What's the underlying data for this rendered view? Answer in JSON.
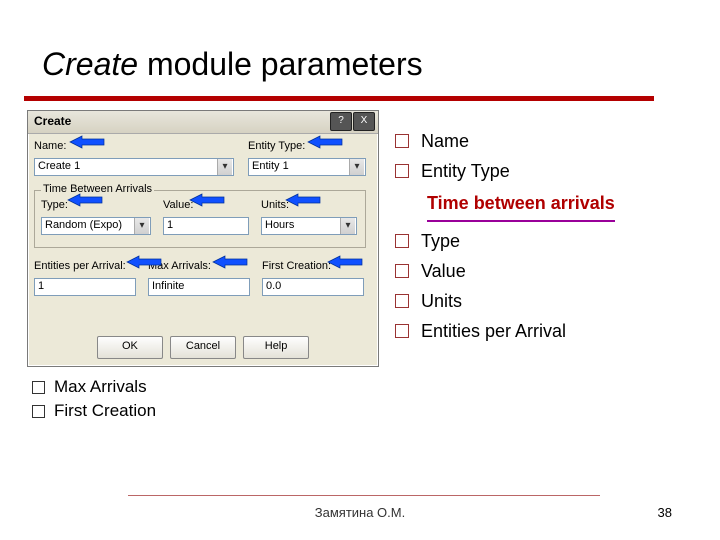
{
  "title": {
    "italic": "Create",
    "rest": " module parameters"
  },
  "dialog": {
    "title": "Create",
    "labels": {
      "name": "Name:",
      "entity_type": "Entity Type:",
      "group": "Time Between Arrivals",
      "type": "Type:",
      "value": "Value:",
      "units": "Units:",
      "entities_per": "Entities per Arrival:",
      "max_arrivals": "Max Arrivals:",
      "first_creation": "First Creation:"
    },
    "fields": {
      "name": "Create 1",
      "entity_type": "Entity 1",
      "type": "Random (Expo)",
      "value": "1",
      "units": "Hours",
      "entities_per": "1",
      "max_arrivals": "Infinite",
      "first_creation": "0.0"
    },
    "buttons": {
      "ok": "OK",
      "cancel": "Cancel",
      "help": "Help"
    },
    "winbtns": {
      "help": "?",
      "close": "X"
    }
  },
  "bullets": {
    "items": [
      "Name",
      "Entity Type"
    ],
    "sub": "Time between arrivals",
    "items2": [
      "Type",
      "Value",
      "Units",
      "Entities per Arrival"
    ]
  },
  "bullets_below": [
    "Max Arrivals",
    "First Creation"
  ],
  "footer": {
    "author": "Замятина О.М.",
    "page": "38"
  }
}
